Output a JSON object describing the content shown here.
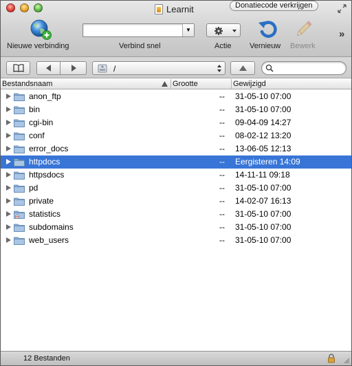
{
  "window": {
    "title": "Learnit",
    "donate_label": "Donatiecode verkrijgen"
  },
  "toolbar": {
    "new_connection_label": "Nieuwe verbinding",
    "quick_connect_label": "Verbind snel",
    "quick_connect_value": "",
    "action_label": "Actie",
    "refresh_label": "Vernieuw",
    "edit_label": "Bewerk",
    "overflow": "»"
  },
  "pathbar": {
    "path": "/",
    "search_value": ""
  },
  "columns": {
    "name": "Bestandsnaam",
    "size": "Grootte",
    "modified": "Gewijzigd"
  },
  "files": [
    {
      "name": "anon_ftp",
      "size": "--",
      "modified": "31-05-10 07:00",
      "icon": "folder-icon",
      "selected": false
    },
    {
      "name": "bin",
      "size": "--",
      "modified": "31-05-10 07:00",
      "icon": "folder-icon",
      "selected": false
    },
    {
      "name": "cgi-bin",
      "size": "--",
      "modified": "09-04-09 14:27",
      "icon": "folder-icon",
      "selected": false
    },
    {
      "name": "conf",
      "size": "--",
      "modified": "08-02-12 13:20",
      "icon": "folder-icon",
      "selected": false
    },
    {
      "name": "error_docs",
      "size": "--",
      "modified": "13-06-05 12:13",
      "icon": "folder-icon",
      "selected": false
    },
    {
      "name": "httpdocs",
      "size": "--",
      "modified": "Eergisteren 14:09",
      "icon": "folder-icon",
      "selected": true
    },
    {
      "name": "httpsdocs",
      "size": "--",
      "modified": "14-11-11 09:18",
      "icon": "folder-icon",
      "selected": false
    },
    {
      "name": "pd",
      "size": "--",
      "modified": "31-05-10 07:00",
      "icon": "folder-icon",
      "selected": false
    },
    {
      "name": "private",
      "size": "--",
      "modified": "14-02-07 16:13",
      "icon": "folder-icon",
      "selected": false
    },
    {
      "name": "statistics",
      "size": "--",
      "modified": "31-05-10 07:00",
      "icon": "folder-restricted-icon",
      "selected": false
    },
    {
      "name": "subdomains",
      "size": "--",
      "modified": "31-05-10 07:00",
      "icon": "folder-icon",
      "selected": false
    },
    {
      "name": "web_users",
      "size": "--",
      "modified": "31-05-10 07:00",
      "icon": "folder-icon",
      "selected": false
    }
  ],
  "status": {
    "count_text": "12 Bestanden"
  },
  "colors": {
    "selection": "#3875d7",
    "folder": "#8fb3d9"
  }
}
